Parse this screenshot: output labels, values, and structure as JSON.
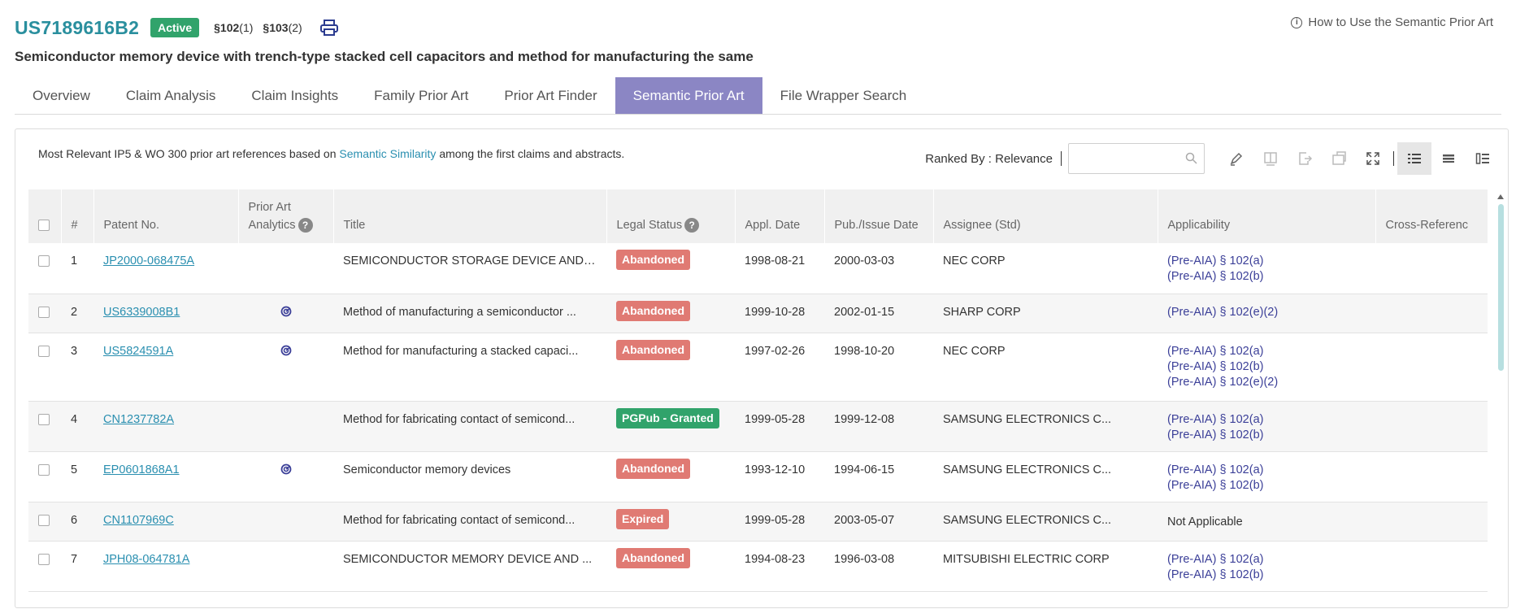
{
  "header": {
    "patent_id": "US7189616B2",
    "status_badge": "Active",
    "sec102_label": "§102",
    "sec102_count": "(1)",
    "sec103_label": "§103",
    "sec103_count": "(2)",
    "print_icon": "printer-icon",
    "help_link": "How to Use the Semantic Prior Art",
    "help_icon": "info-icon",
    "title": "Semiconductor memory device with trench-type stacked cell capacitors and method for manufacturing the same"
  },
  "tabs": [
    {
      "label": "Overview",
      "active": false
    },
    {
      "label": "Claim Analysis",
      "active": false
    },
    {
      "label": "Claim Insights",
      "active": false
    },
    {
      "label": "Family Prior Art",
      "active": false
    },
    {
      "label": "Prior Art Finder",
      "active": false
    },
    {
      "label": "Semantic Prior Art",
      "active": true
    },
    {
      "label": "File Wrapper Search",
      "active": false
    }
  ],
  "panel": {
    "desc_prefix": "Most Relevant IP5 & WO 300 prior art references based on ",
    "desc_link": "Semantic Similarity",
    "desc_suffix": " among the first claims and abstracts.",
    "ranked_by": "Ranked By : Relevance",
    "search_value": "",
    "toolbar_icons": [
      "search-icon",
      "highlight-pen-icon",
      "book-icon",
      "export-icon",
      "save-icon",
      "expand-icon",
      "list-view-icon",
      "compact-view-icon",
      "detail-view-icon"
    ]
  },
  "table": {
    "headers": {
      "num": "#",
      "patent_no": "Patent No.",
      "analytics_1": "Prior Art",
      "analytics_2": "Analytics",
      "title": "Title",
      "legal_status": "Legal Status",
      "appl_date": "Appl. Date",
      "pub_date": "Pub./Issue Date",
      "assignee": "Assignee (Std)",
      "applicability": "Applicability",
      "cross_ref": "Cross-Referenc"
    },
    "rows": [
      {
        "num": "1",
        "patent_no": "JP2000-068475A",
        "analytics": false,
        "title": "SEMICONDUCTOR STORAGE DEVICE AND I...",
        "status": "Abandoned",
        "status_color": "#e07a73",
        "appl_date": "1998-08-21",
        "pub_date": "2000-03-03",
        "assignee": "NEC CORP",
        "applicability": [
          "(Pre-AIA) § 102(a)",
          "(Pre-AIA) § 102(b)"
        ]
      },
      {
        "num": "2",
        "patent_no": "US6339008B1",
        "analytics": true,
        "title": "Method of manufacturing a semiconductor ...",
        "status": "Abandoned",
        "status_color": "#e07a73",
        "appl_date": "1999-10-28",
        "pub_date": "2002-01-15",
        "assignee": "SHARP CORP",
        "applicability": [
          "(Pre-AIA) § 102(e)(2)"
        ]
      },
      {
        "num": "3",
        "patent_no": "US5824591A",
        "analytics": true,
        "title": "Method for manufacturing a stacked capaci...",
        "status": "Abandoned",
        "status_color": "#e07a73",
        "appl_date": "1997-02-26",
        "pub_date": "1998-10-20",
        "assignee": "NEC CORP",
        "applicability": [
          "(Pre-AIA) § 102(a)",
          "(Pre-AIA) § 102(b)",
          "(Pre-AIA) § 102(e)(2)"
        ]
      },
      {
        "num": "4",
        "patent_no": "CN1237782A",
        "analytics": false,
        "title": "Method for fabricating contact of semicond...",
        "status": "PGPub - Granted",
        "status_color": "#31a36b",
        "appl_date": "1999-05-28",
        "pub_date": "1999-12-08",
        "assignee": "SAMSUNG ELECTRONICS C...",
        "applicability": [
          "(Pre-AIA) § 102(a)",
          "(Pre-AIA) § 102(b)"
        ]
      },
      {
        "num": "5",
        "patent_no": "EP0601868A1",
        "analytics": true,
        "title": "Semiconductor memory devices",
        "status": "Abandoned",
        "status_color": "#e07a73",
        "appl_date": "1993-12-10",
        "pub_date": "1994-06-15",
        "assignee": "SAMSUNG ELECTRONICS C...",
        "applicability": [
          "(Pre-AIA) § 102(a)",
          "(Pre-AIA) § 102(b)"
        ]
      },
      {
        "num": "6",
        "patent_no": "CN1107969C",
        "analytics": false,
        "title": "Method for fabricating contact of semicond...",
        "status": "Expired",
        "status_color": "#e07a73",
        "appl_date": "1999-05-28",
        "pub_date": "2003-05-07",
        "assignee": "SAMSUNG ELECTRONICS C...",
        "applicability_plain": "Not Applicable",
        "applicability": []
      },
      {
        "num": "7",
        "patent_no": "JPH08-064781A",
        "analytics": false,
        "title": "SEMICONDUCTOR MEMORY DEVICE AND ...",
        "status": "Abandoned",
        "status_color": "#e07a73",
        "appl_date": "1994-08-23",
        "pub_date": "1996-03-08",
        "assignee": "MITSUBISHI ELECTRIC CORP",
        "applicability": [
          "(Pre-AIA) § 102(a)",
          "(Pre-AIA) § 102(b)"
        ]
      }
    ]
  }
}
